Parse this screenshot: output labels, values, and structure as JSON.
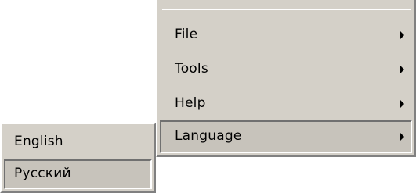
{
  "main_menu": {
    "items": [
      {
        "label": "File",
        "has_submenu": true,
        "icon": "chevron-right-icon"
      },
      {
        "label": "Tools",
        "has_submenu": true,
        "icon": "chevron-right-icon"
      },
      {
        "label": "Help",
        "has_submenu": true,
        "icon": "chevron-right-icon"
      },
      {
        "label": "Language",
        "has_submenu": true,
        "icon": "chevron-right-icon",
        "state": "open"
      }
    ]
  },
  "language_menu": {
    "items": [
      {
        "label": "English"
      },
      {
        "label": "Русский",
        "state": "pressed"
      }
    ]
  },
  "colors": {
    "menu_face": "#d4d0c8",
    "menu_highlight": "#ffffff",
    "menu_shadow": "#808080",
    "pressed_face": "#c7c3bb",
    "text": "#000000"
  }
}
